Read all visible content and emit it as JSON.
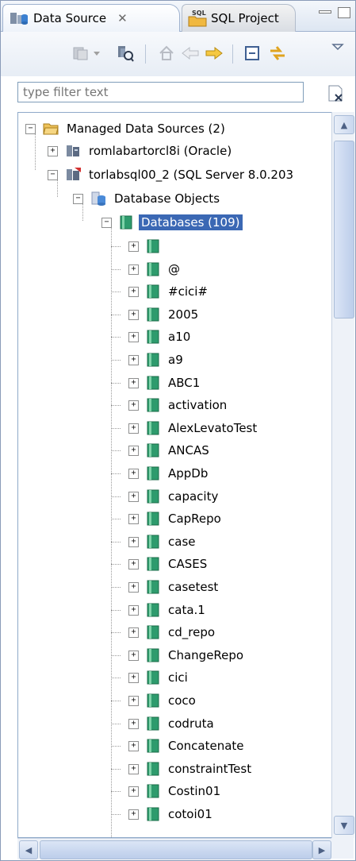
{
  "tabs": [
    {
      "label": "Data Source",
      "active": true
    },
    {
      "label": "SQL Project",
      "active": false
    }
  ],
  "filter": {
    "placeholder": "type filter text",
    "value": "type filter text"
  },
  "tree": {
    "root": {
      "label": "Managed Data Sources (2)"
    },
    "connections": [
      {
        "label": "romlabartorcl8i (Oracle)"
      },
      {
        "label": "torlabsql00_2 (SQL Server 8.0.203"
      }
    ],
    "database_objects": {
      "label": "Database Objects"
    },
    "databases": {
      "label": "Databases (109)"
    },
    "db_items": [
      "",
      "@",
      "#cici#",
      "2005",
      "a10",
      "a9",
      "ABC1",
      "activation",
      "AlexLevatoTest",
      "ANCAS",
      "AppDb",
      "capacity",
      "CapRepo",
      "case",
      "CASES",
      "casetest",
      "cata.1",
      "cd_repo",
      "ChangeRepo",
      "cici",
      "coco",
      "codruta",
      "Concatenate",
      "constraintTest",
      "Costin01",
      "cotoi01"
    ]
  },
  "colors": {
    "selection": "#3b68b4",
    "db_icon": "#2e9b6d",
    "folder": "#e8b94c"
  }
}
